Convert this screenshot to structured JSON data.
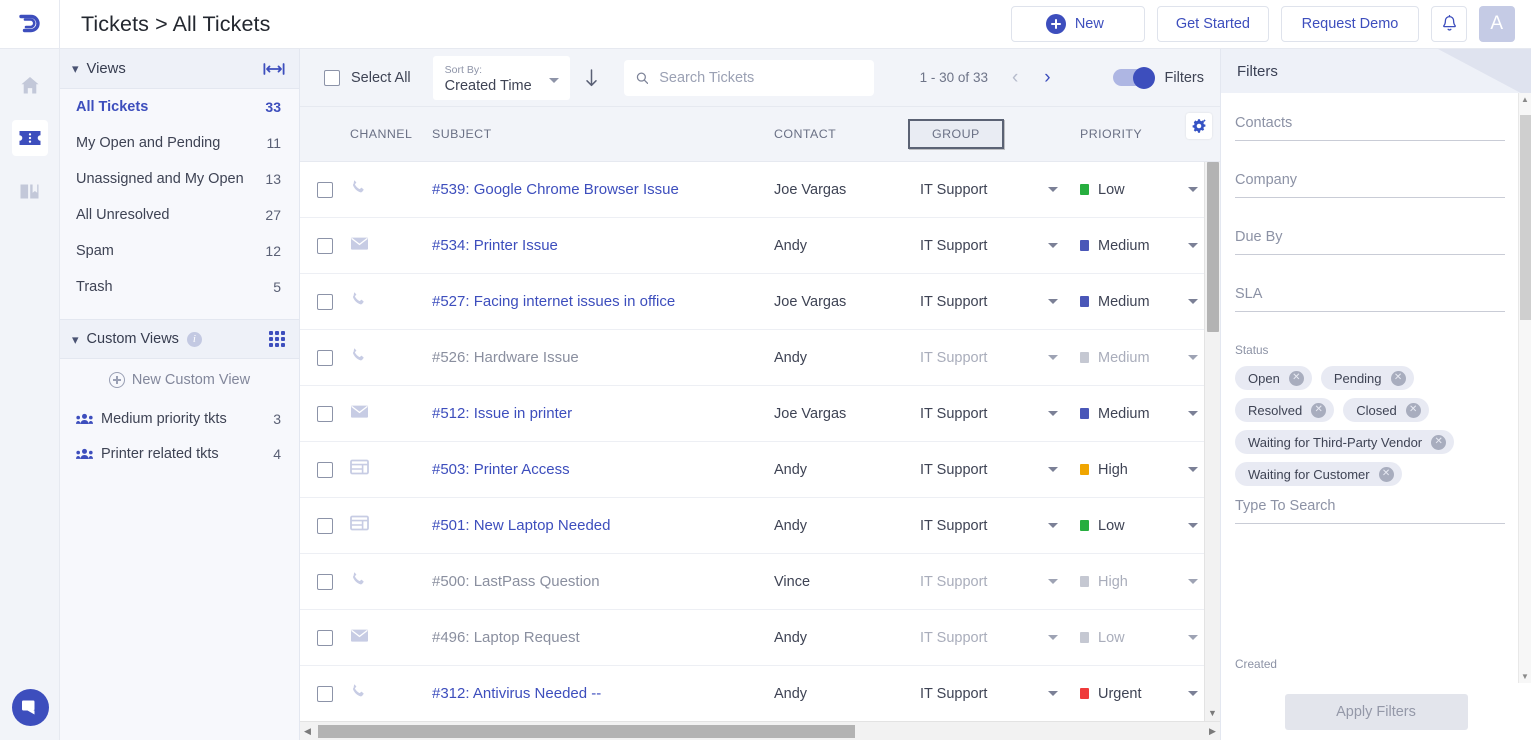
{
  "header": {
    "logo_icon": "freshdesk-logo-icon",
    "title": "Tickets > All Tickets",
    "new_label": "New",
    "get_started_label": "Get Started",
    "request_demo_label": "Request Demo",
    "bell_icon": "bell-icon",
    "avatar_initial": "A"
  },
  "rail": {
    "items": [
      {
        "icon": "home-icon",
        "active": false
      },
      {
        "icon": "ticket-icon",
        "active": true
      },
      {
        "icon": "solutions-book-icon",
        "active": false
      }
    ],
    "chat_icon": "chat-icon"
  },
  "sidebar": {
    "views_header": "Views",
    "expand_icon": "expand-width-icon",
    "views": [
      {
        "label": "All Tickets",
        "count": "33",
        "selected": true
      },
      {
        "label": "My Open and Pending",
        "count": "11",
        "selected": false
      },
      {
        "label": "Unassigned and My Open",
        "count": "13",
        "selected": false
      },
      {
        "label": "All Unresolved",
        "count": "27",
        "selected": false
      },
      {
        "label": "Spam",
        "count": "12",
        "selected": false
      },
      {
        "label": "Trash",
        "count": "5",
        "selected": false
      }
    ],
    "custom_views_header": "Custom Views",
    "info_icon": "info-icon",
    "grid_icon": "grid-dots-icon",
    "new_custom_view": "New Custom View",
    "custom_views": [
      {
        "label": "Medium priority tkts",
        "count": "3",
        "icon": "group-icon"
      },
      {
        "label": "Printer related tkts",
        "count": "4",
        "icon": "group-icon"
      }
    ]
  },
  "toolbar": {
    "select_all": "Select All",
    "sort_by_caption": "Sort By:",
    "sort_by_value": "Created Time",
    "sort_direction_icon": "arrow-down-icon",
    "search_icon": "search-icon",
    "search_placeholder": "Search Tickets",
    "search_value": "",
    "pagination_range": "1 - 30 of 33",
    "prev_icon": "chevron-left-icon",
    "next_icon": "chevron-right-icon",
    "filters_label": "Filters",
    "filters_on": true
  },
  "table": {
    "columns": {
      "channel": "CHANNEL",
      "subject": "SUBJECT",
      "contact": "CONTACT",
      "group": "GROUP",
      "priority": "PRIORITY"
    },
    "settings_icon": "gear-settings-icon",
    "group_header_focused": true,
    "rows": [
      {
        "channel_icon": "phone-icon",
        "subject": "#539: Google Chrome Browser Issue",
        "contact": "Joe Vargas",
        "group": "IT Support",
        "priority": "Low",
        "priority_color": "#27ae3f",
        "read": false
      },
      {
        "channel_icon": "email-icon",
        "subject": "#534: Printer Issue",
        "contact": "Andy",
        "group": "IT Support",
        "priority": "Medium",
        "priority_color": "#4a57b8",
        "read": false
      },
      {
        "channel_icon": "phone-icon",
        "subject": "#527: Facing internet issues in office",
        "contact": "Joe Vargas",
        "group": "IT Support",
        "priority": "Medium",
        "priority_color": "#4a57b8",
        "read": false
      },
      {
        "channel_icon": "phone-icon",
        "subject": "#526: Hardware Issue",
        "contact": "Andy",
        "group": "IT Support",
        "priority": "Medium",
        "priority_color": "#c5c8d2",
        "read": true
      },
      {
        "channel_icon": "email-icon",
        "subject": "#512: Issue in printer",
        "contact": "Joe Vargas",
        "group": "IT Support",
        "priority": "Medium",
        "priority_color": "#4a57b8",
        "read": false
      },
      {
        "channel_icon": "portal-icon",
        "subject": "#503: Printer Access",
        "contact": "Andy",
        "group": "IT Support",
        "priority": "High",
        "priority_color": "#f0a500",
        "read": false
      },
      {
        "channel_icon": "portal-icon",
        "subject": "#501: New Laptop Needed",
        "contact": "Andy",
        "group": "IT Support",
        "priority": "Low",
        "priority_color": "#27ae3f",
        "read": false
      },
      {
        "channel_icon": "phone-icon",
        "subject": "#500: LastPass Question",
        "contact": "Vince",
        "group": "IT Support",
        "priority": "High",
        "priority_color": "#c5c8d2",
        "read": true
      },
      {
        "channel_icon": "email-icon",
        "subject": "#496: Laptop Request",
        "contact": "Andy",
        "group": "IT Support",
        "priority": "Low",
        "priority_color": "#c5c8d2",
        "read": true
      },
      {
        "channel_icon": "phone-icon",
        "subject": "#312: Antivirus Needed --",
        "contact": "Andy",
        "group": "IT Support",
        "priority": "Urgent",
        "priority_color": "#ef3b3b",
        "read": false
      }
    ]
  },
  "filters": {
    "title": "Filters",
    "fields": [
      {
        "placeholder": "Contacts"
      },
      {
        "placeholder": "Company"
      },
      {
        "placeholder": "Due By"
      },
      {
        "placeholder": "SLA"
      }
    ],
    "status_label": "Status",
    "status_chips": [
      "Open",
      "Pending",
      "Resolved",
      "Closed",
      "Waiting for Third-Party Vendor",
      "Waiting for Customer"
    ],
    "status_search_placeholder": "Type To Search",
    "created_label": "Created",
    "apply_label": "Apply Filters"
  },
  "colors": {
    "brand": "#3d4ebd",
    "link": "#3d4ebd",
    "panel_bg": "#f2f4f9",
    "sidebar_bg": "#f7f8fc"
  }
}
